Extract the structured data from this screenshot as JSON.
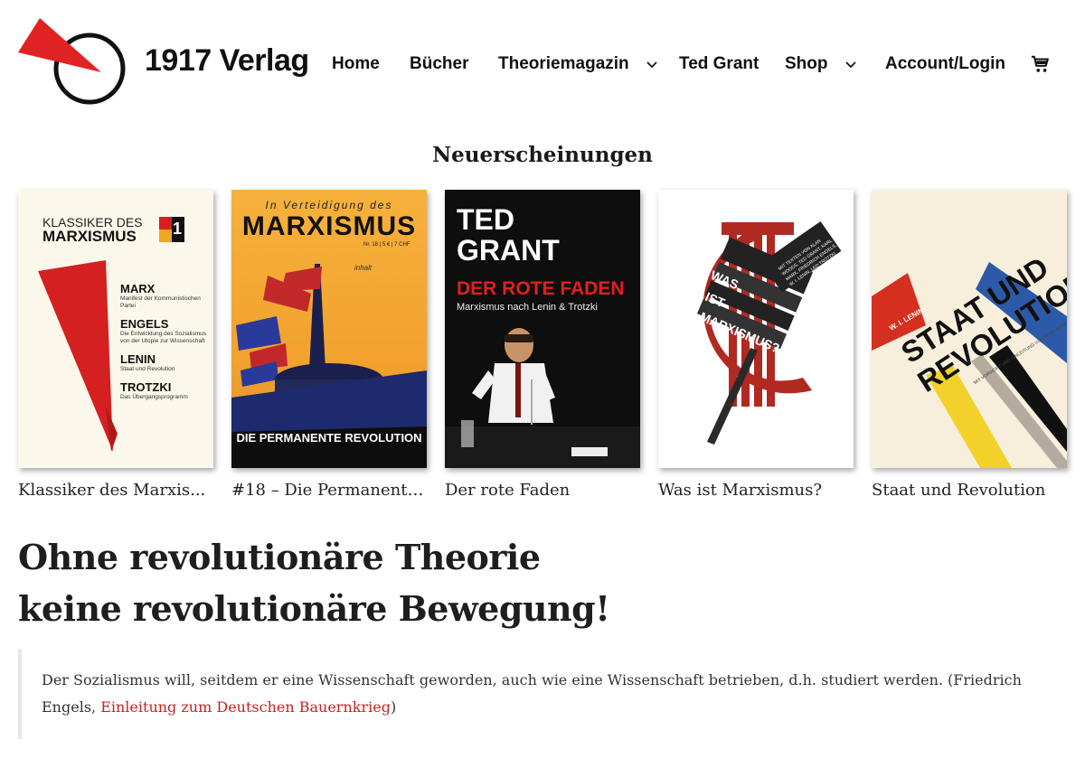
{
  "site": {
    "title": "1917 Verlag"
  },
  "nav": {
    "items": [
      {
        "label": "Home"
      },
      {
        "label": "Bücher"
      },
      {
        "label": "Theoriemagazin"
      },
      {
        "label": "Ted Grant"
      },
      {
        "label": "Shop"
      },
      {
        "label": "Account/Login"
      }
    ]
  },
  "colors": {
    "accent_red": "#d42020",
    "link_red": "#cc1f1f",
    "text_dark": "#1e1e1e"
  },
  "icons": {
    "logo": "red-triangle-circle-logo",
    "dropdown": "chevron-down-icon",
    "cart": "cart-icon"
  },
  "new_releases": {
    "heading": "Neuerscheinungen",
    "books": [
      {
        "title": "Klassiker des Marxis...",
        "cover": {
          "series_line1": "KLASSIKER DES",
          "series_line2": "MARXISMUS",
          "badge": "1",
          "entries": [
            {
              "name": "MARX",
              "sub": "Manifest der Kommunistischen Partei"
            },
            {
              "name": "ENGELS",
              "sub": "Die Entwicklung des Sozialismus von der Utopie zur Wissenschaft"
            },
            {
              "name": "LENIN",
              "sub": "Staat und Revolution"
            },
            {
              "name": "TROTZKI",
              "sub": "Das Übergangsprogramm"
            }
          ]
        }
      },
      {
        "title": "#18 – Die Permanente ...",
        "cover": {
          "top": "In Verteidigung des",
          "masthead": "MARXISMUS",
          "issue": "Nr. 18 | 5 € | 7 CHF",
          "inhalt": "inhalt",
          "bottom": "DIE PERMANENTE REVOLUTION"
        }
      },
      {
        "title": "Der rote Faden",
        "cover": {
          "author_line1": "TED",
          "author_line2": "GRANT",
          "book_title": "DER ROTE FADEN",
          "subtitle": "Marxismus nach Lenin & Trotzki"
        }
      },
      {
        "title": "Was ist Marxismus?",
        "cover": {
          "words": [
            "WAS",
            "IST",
            "MARXISMUS?"
          ],
          "side_text": "MIT TEXTEN VON ALAN WOODS, TED GRANT, KARL MARX, FRIEDRICH ENGELS, W. I. LENIN, LEO TROTZKI"
        }
      },
      {
        "title": "Staat und Revolution",
        "cover": {
          "author": "W. I. LENIN",
          "line1": "STAAT UND",
          "line2": "REVOLUTION",
          "note": "MIT VORWORT UND EINLEITUNG VON ALAN WOODS"
        }
      }
    ]
  },
  "headline": {
    "line1": "Ohne revolutionäre Theorie",
    "line2": "keine revolutionäre Bewegung!"
  },
  "quote": {
    "text": "Der Sozialismus will, seitdem er eine Wissenschaft geworden, auch wie eine Wissenschaft betrieben, d.h. studiert werden. (Friedrich Engels, ",
    "link_text": "Einleitung zum Deutschen Bauernkrieg",
    "closing": ")"
  }
}
